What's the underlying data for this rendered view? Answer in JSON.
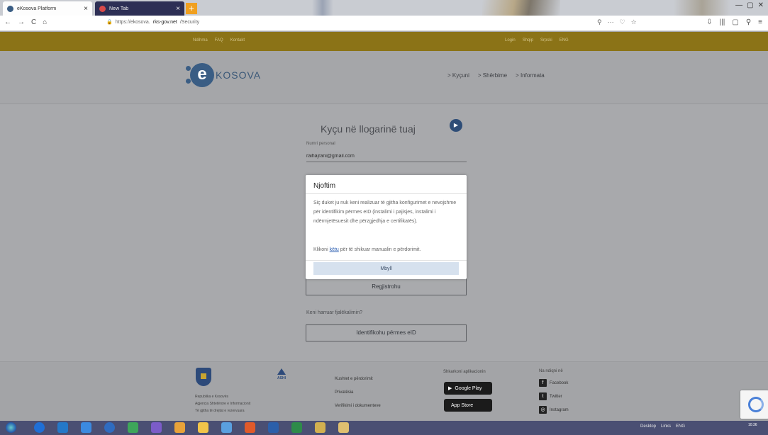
{
  "browser": {
    "tabs": [
      {
        "title": "eKosova Platform",
        "favicon_color": "#3a5d84"
      },
      {
        "title": "New Tab",
        "favicon_color": "#d94a4a"
      }
    ],
    "newtab_symbol": "+",
    "close_symbol": "×",
    "url": {
      "prefix": "https://ekosova.",
      "domain": "rks-gov.net",
      "path": "/Security"
    },
    "nav": [
      "←",
      "→",
      "C",
      "⌂"
    ],
    "url_icons": [
      "⚲",
      "···",
      "♡",
      "☆"
    ],
    "toolbar_icons": [
      "⇩",
      "|||",
      "▢",
      "⚲",
      "≡"
    ],
    "window_controls": [
      "—",
      "▢",
      "✕"
    ]
  },
  "topbar": {
    "left_links": [
      "Ndihma",
      "FAQ",
      "Kontakt"
    ],
    "right_links": [
      "Login",
      "Shqip",
      "Srpski",
      "ENG"
    ]
  },
  "header": {
    "logo_e": "e",
    "logo_text": "KOSOVA",
    "nav": [
      "> Kyçuni",
      "> Shërbime",
      "> Informata"
    ]
  },
  "login": {
    "title": "Kyçu në llogarinë tuaj",
    "play_icon": "▶",
    "username_label": "Numri personal",
    "username_value": "raihajrani@gmail.com",
    "register_button": "Regjistrohu",
    "forgot_text": "Keni harruar fjalëkalimin?",
    "eid_button": "Identifikohu përmes eID"
  },
  "modal": {
    "title": "Njoftim",
    "body": "Siç duket ju nuk keni realizuar të gjitha konfigurimet e nevojshme për identifikim përmes eID (instalimi i pajisjes, instalimi i ndërmjetësuesit dhe përzgjedhja e certifikatës).",
    "link_pre": "Klikoni",
    "link_text": "këtu",
    "link_post": "për të shikuar manualin e përdorimit.",
    "button": "Mbyll"
  },
  "footer": {
    "left_lines": [
      "Republika e Kosovës",
      "Agjencia Shtetërore e Informacionit",
      "Të gjitha të drejtat e rezervuara"
    ],
    "ashi_label": "ASHI",
    "links": [
      "Kushtet e përdorimit",
      "Privatësia",
      "Verifikimi i dokumenteve"
    ],
    "apps_label": "Shkarkoni aplikacionin",
    "google_play": "Google Play",
    "app_store": "App Store",
    "social_label": "Na ndiqni në",
    "social": [
      {
        "name": "Facebook",
        "glyph": "f"
      },
      {
        "name": "Twitter",
        "glyph": "t"
      },
      {
        "name": "Instagram",
        "glyph": "◎"
      }
    ]
  },
  "taskbar": {
    "icon_colors": [
      "#1f6fd6",
      "#2478c8",
      "#3b8ae0",
      "#2f6cc0",
      "#3ea65a",
      "#7b5cc8",
      "#e8a23a",
      "#f2c54a",
      "#5aa0e0",
      "#e05a2a",
      "#2b5faa",
      "#2e8b4a",
      "#d2b050",
      "#e0c070"
    ],
    "tray": [
      "Desktop",
      "Links",
      "ENG"
    ],
    "clock": "10:36"
  }
}
